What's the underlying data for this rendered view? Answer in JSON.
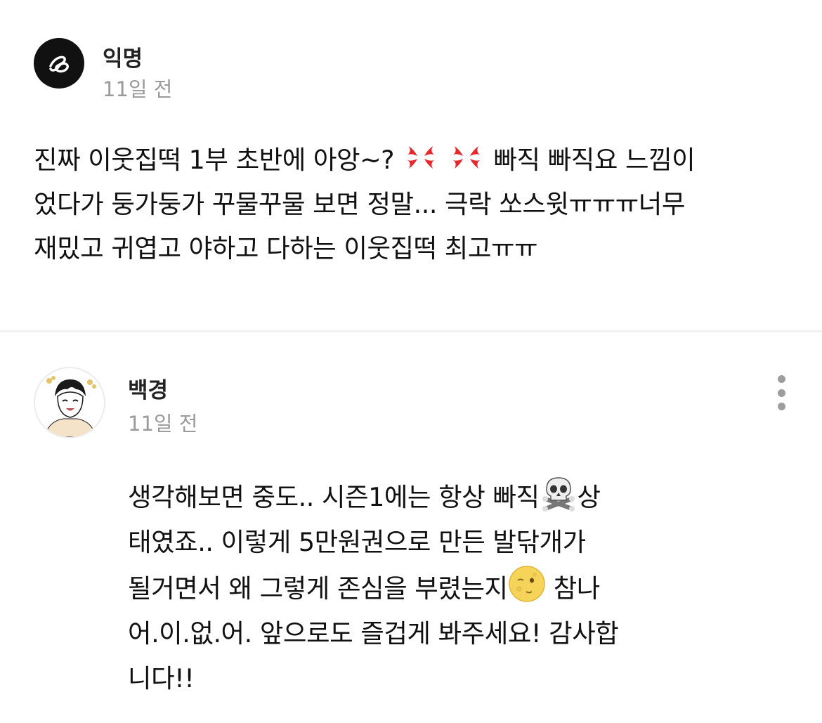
{
  "comments": [
    {
      "author": "익명",
      "time": "11일 전",
      "avatar_icon": "anonymous-logo-icon",
      "lines": [
        "진짜 이웃집떡 1부 초반에 아앙~?",
        "빠직 빠직요 느낌이",
        "었다가 둥가둥가 꾸물꾸물 보면 정말... 극락 쏘스윗ㅠㅠㅠ너무",
        "재밌고 귀엽고 야하고 다하는 이웃집떡 최고ㅠㅠ"
      ],
      "emoji_icons": [
        "anger-symbol-icon",
        "anger-symbol-icon"
      ]
    },
    {
      "author": "백경",
      "time": "11일 전",
      "avatar_icon": "user-avatar-illustration",
      "more_icon": "more-vertical-icon",
      "text_parts": [
        "생각해보면 중도.. 시즌1에는 항상 빠직",
        "상",
        "태였죠.. 이렇게 5만원권으로 만든 발닦개가",
        "될거면서 왜 그렇게 존심을 부렸는지",
        " 참나",
        "어.이.없.어. 앞으로도 즐겁게 봐주세요! 감사합",
        "니다!!"
      ],
      "emoji_icons": [
        "skull-crossbones-icon",
        "full-moon-face-icon"
      ]
    }
  ],
  "colors": {
    "text": "#111111",
    "meta": "#9a9a9a",
    "divider": "#f1f1f3",
    "more": "#9d9d9d"
  }
}
